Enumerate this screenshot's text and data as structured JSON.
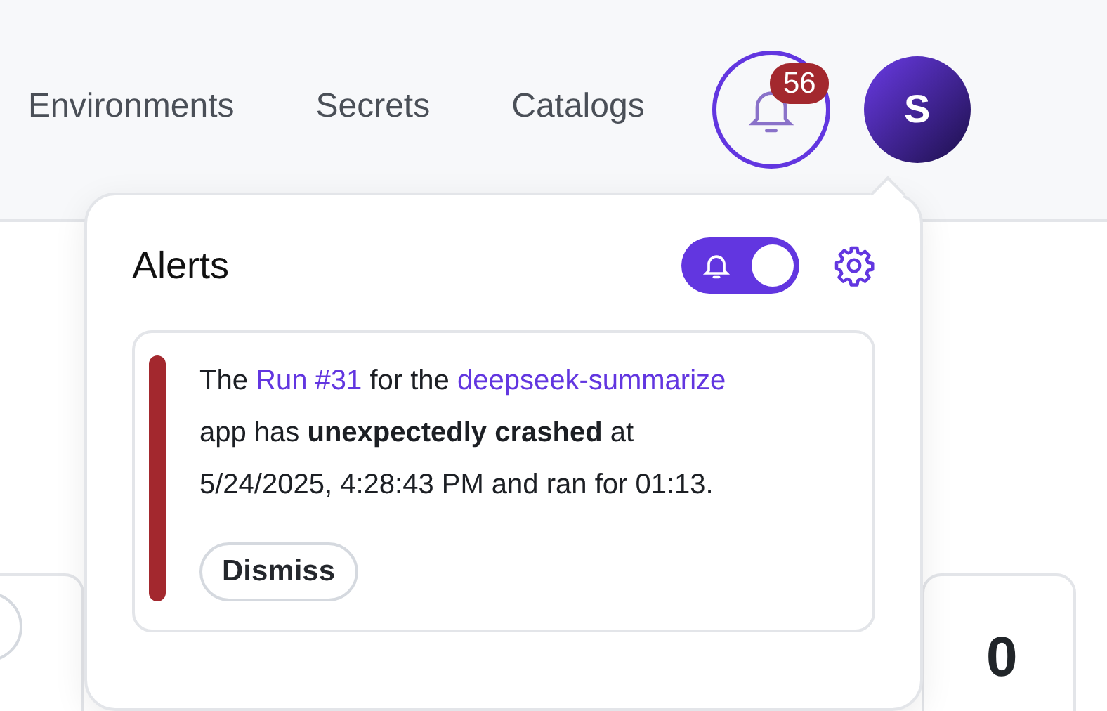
{
  "nav": {
    "links": [
      {
        "label": "Environments"
      },
      {
        "label": "Secrets"
      },
      {
        "label": "Catalogs"
      }
    ],
    "notifications": {
      "count": "56"
    },
    "avatar": {
      "initial": "S"
    }
  },
  "alerts_popover": {
    "title": "Alerts",
    "notifications_toggle": {
      "on": true
    },
    "alerts": [
      {
        "color": "#a3282e",
        "message": [
          {
            "kind": "text",
            "text": "The "
          },
          {
            "kind": "link",
            "text": "Run #31"
          },
          {
            "kind": "text",
            "text": " for the "
          },
          {
            "kind": "link",
            "text": "deepseek-summarize"
          },
          {
            "kind": "text",
            "text": " app has **unexpectedly crashed** at 5/24/2025, 4:28:43 PM and ran for 01:13."
          }
        ],
        "action": "Dismiss"
      }
    ]
  },
  "stat_card": {
    "value": "0"
  }
}
